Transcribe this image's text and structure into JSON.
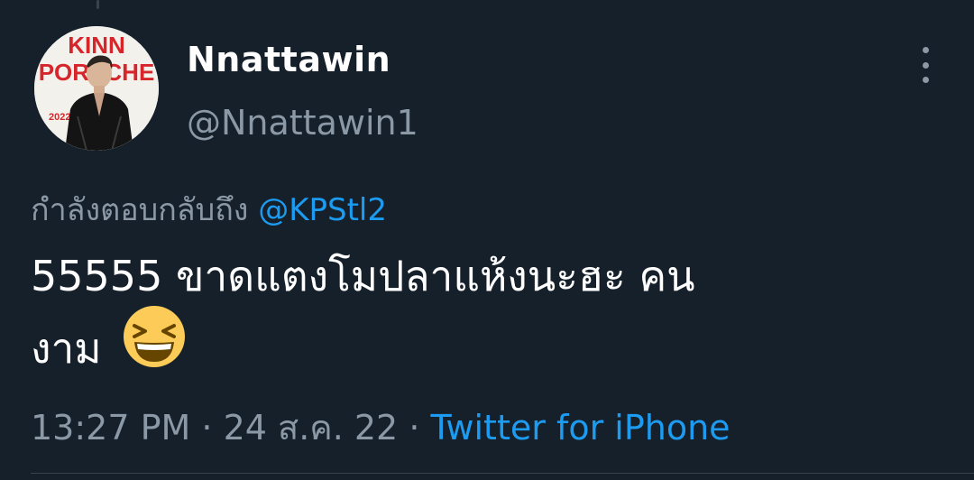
{
  "tweet": {
    "author": {
      "display_name": "Nnattawin",
      "handle": "@Nnattawin1",
      "avatar_poster_title_line1": "KINN",
      "avatar_poster_title_line2": "PORSCHE",
      "avatar_poster_year": "2022"
    },
    "reply_prefix": "กำลังตอบกลับถึง",
    "reply_mention": "@KPStl2",
    "text_line1": "55555 ขาดแตงโมปลาแห้งนะฮะ คน",
    "text_line2": "งาม",
    "emoji": "grinning-squinting-face",
    "time": "13:27 PM",
    "separator": "·",
    "date": "24 ส.ค. 22",
    "source": "Twitter for iPhone"
  },
  "colors": {
    "background": "#15202b",
    "primary_text": "#ffffff",
    "secondary_text": "#8b98a5",
    "link": "#1d9bf0",
    "divider": "#38444d"
  },
  "icons": {
    "more": "more-vertical-icon"
  }
}
